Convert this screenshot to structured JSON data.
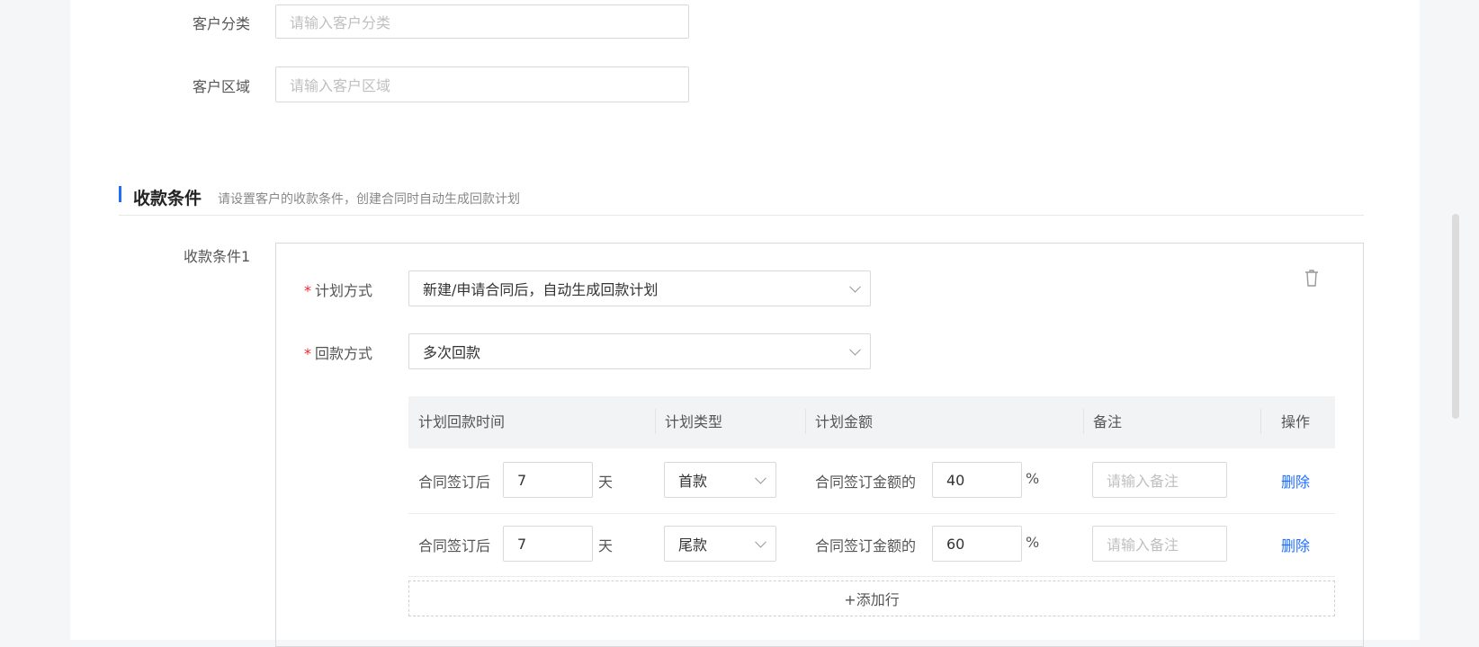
{
  "form": {
    "customer_category": {
      "label": "客户分类",
      "placeholder": "请输入客户分类"
    },
    "customer_region": {
      "label": "客户区域",
      "placeholder": "请输入客户区域"
    }
  },
  "section": {
    "title": "收款条件",
    "subtitle": "请设置客户的收款条件，创建合同时自动生成回款计划"
  },
  "condition": {
    "label": "收款条件1",
    "plan_method": {
      "label": "计划方式",
      "value": "新建/申请合同后，自动生成回款计划"
    },
    "payment_method": {
      "label": "回款方式",
      "value": "多次回款"
    },
    "table": {
      "headers": [
        "计划回款时间",
        "计划类型",
        "计划金额",
        "备注",
        "操作"
      ],
      "rows": [
        {
          "prefix": "合同签订后",
          "days": "7",
          "unit": "天",
          "type": "首款",
          "amount_prefix": "合同签订金额的",
          "percent": "40",
          "percent_unit": "%",
          "note_placeholder": "请输入备注",
          "action": "删除"
        },
        {
          "prefix": "合同签订后",
          "days": "7",
          "unit": "天",
          "type": "尾款",
          "amount_prefix": "合同签订金额的",
          "percent": "60",
          "percent_unit": "%",
          "note_placeholder": "请输入备注",
          "action": "删除"
        }
      ],
      "add_row": "+添加行"
    }
  },
  "colors": {
    "accent": "#1f6fff",
    "required": "#f5222d",
    "header_bg": "#f2f3f5"
  }
}
